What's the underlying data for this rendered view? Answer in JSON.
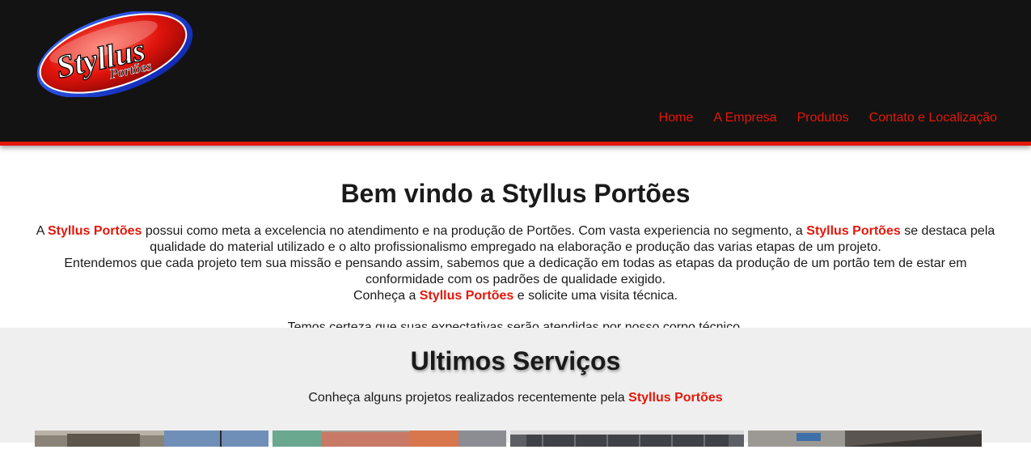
{
  "brand": {
    "logo_main": "Styllus",
    "logo_sub": "Portões",
    "name": "Styllus Portões",
    "accent_color": "#e3170a",
    "header_bg": "#131313"
  },
  "nav": {
    "items": [
      {
        "label": "Home"
      },
      {
        "label": "A Empresa"
      },
      {
        "label": "Produtos"
      },
      {
        "label": "Contato e Localização"
      }
    ]
  },
  "welcome": {
    "title": "Bem vindo a Styllus Portões",
    "p1_a": "A ",
    "p1_b": " possui como meta a excelencia no atendimento e na produção de Portões. Com vasta experiencia no segmento, a ",
    "p1_c": " se destaca pela qualidade do material utilizado e o alto profissionalismo empregado na elaboração e produção das varias etapas de um projeto.",
    "p2": "Entendemos que cada projeto tem sua missão e pensando assim, sabemos que a dedicação em todas as etapas da produção de um portão tem de estar em conformidade com os padrões de qualidade exigido.",
    "p3_a": "Conheça a ",
    "p3_b": " e solicite uma visita técnica.",
    "p4": "Temos certeza que suas expectativas serão atendidas por nosso corpo técnico."
  },
  "services": {
    "title": "Ultimos Serviços",
    "sub_a": "Conheça alguns projetos realizados recentemente pela "
  }
}
